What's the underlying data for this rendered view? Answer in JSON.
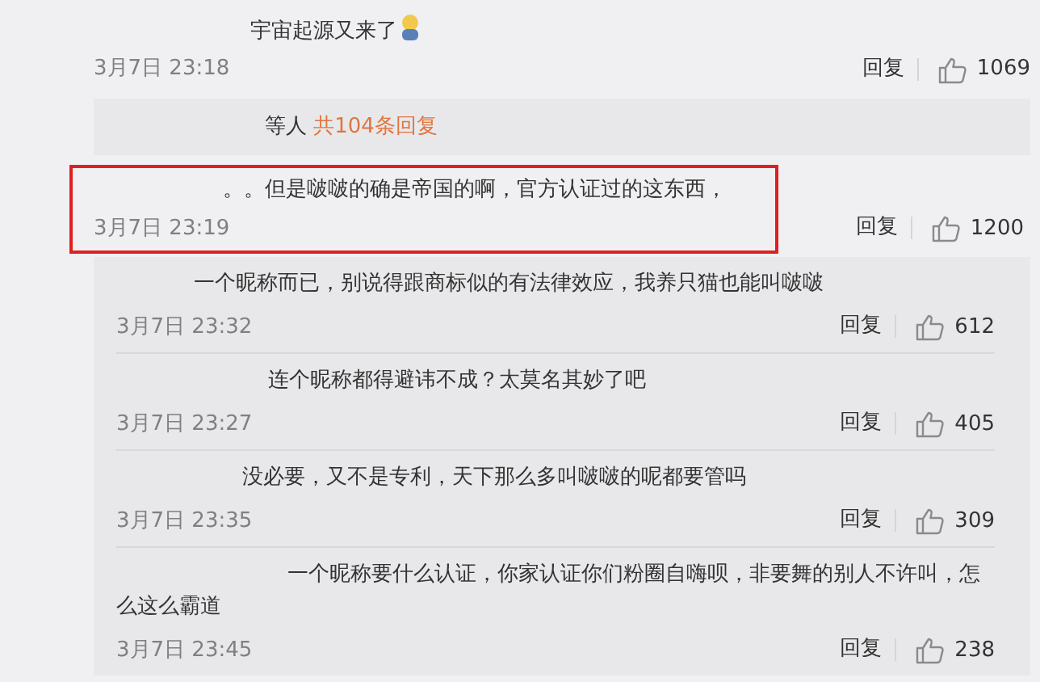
{
  "comment": {
    "text": "宇宙起源又来了",
    "emoji": true,
    "time": "3月7日 23:18",
    "reply_label": "回复",
    "likes": "1069"
  },
  "reply_summary": {
    "text": "等人",
    "link": "共104条回复"
  },
  "highlighted_comment": {
    "text": "。。但是啵啵的确是帝国的啊，官方认证过的这东西，",
    "highlighted": true,
    "time": "3月7日 23:19",
    "reply_label": "回复",
    "likes": "1200"
  },
  "replies": [
    {
      "text": "一个昵称而已，别说得跟商标似的有法律效应，我养只猫也能叫啵啵",
      "time": "3月7日 23:32",
      "reply_label": "回复",
      "likes": "612"
    },
    {
      "text": "连个昵称都得避讳不成？太莫名其妙了吧",
      "time": "3月7日 23:27",
      "reply_label": "回复",
      "likes": "405"
    },
    {
      "text": "没必要，又不是专利，天下那么多叫啵啵的呢都要管吗",
      "time": "3月7日 23:35",
      "reply_label": "回复",
      "likes": "309"
    },
    {
      "text": "一个昵称要什么认证，你家认证你们粉圈自嗨呗，非要舞的别人不许叫，怎么这么霸道",
      "time": "3月7日 23:45",
      "reply_label": "回复",
      "likes": "238"
    }
  ]
}
